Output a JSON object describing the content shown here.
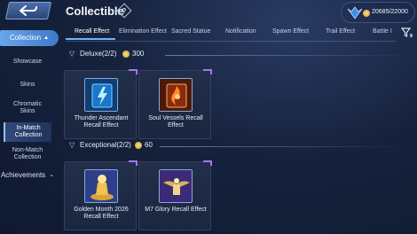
{
  "header": {
    "title": "Collectible",
    "help_icon": "?",
    "currency_amount": "20685/22000",
    "back_icon": "back-arrow-icon"
  },
  "sidebar": {
    "collection_label": "Collection",
    "items": [
      {
        "label": "Showcase"
      },
      {
        "label": "Skins"
      },
      {
        "label": "Chromatic Skins"
      },
      {
        "label": "In-Match Collection"
      },
      {
        "label": "Non-Match Collection"
      }
    ],
    "achievements_label": "Achievements"
  },
  "tabs": [
    {
      "label": "Recall Effect",
      "active": true
    },
    {
      "label": "Elimination Effect"
    },
    {
      "label": "Sacred Statue"
    },
    {
      "label": "Notification"
    },
    {
      "label": "Spawn Effect"
    },
    {
      "label": "Trail Effect"
    },
    {
      "label": "Battle I"
    }
  ],
  "sections": [
    {
      "name": "Deluxe(2/2)",
      "points": "300",
      "items": [
        {
          "label": "Thunder Ascendant Recall Effect"
        },
        {
          "label": "Soul Vessels Recall Effect"
        }
      ]
    },
    {
      "name": "Exceptional(2/2)",
      "points": "60",
      "items": [
        {
          "label": "Golden Month 2026 Recall Effect"
        },
        {
          "label": "M7 Glory Recall Effect"
        }
      ]
    }
  ],
  "colors": {
    "accent": "#6fb2ff",
    "sidebar_active": "#4f8ad6",
    "card_border": "#31405e",
    "coin": "#e8b94a"
  }
}
